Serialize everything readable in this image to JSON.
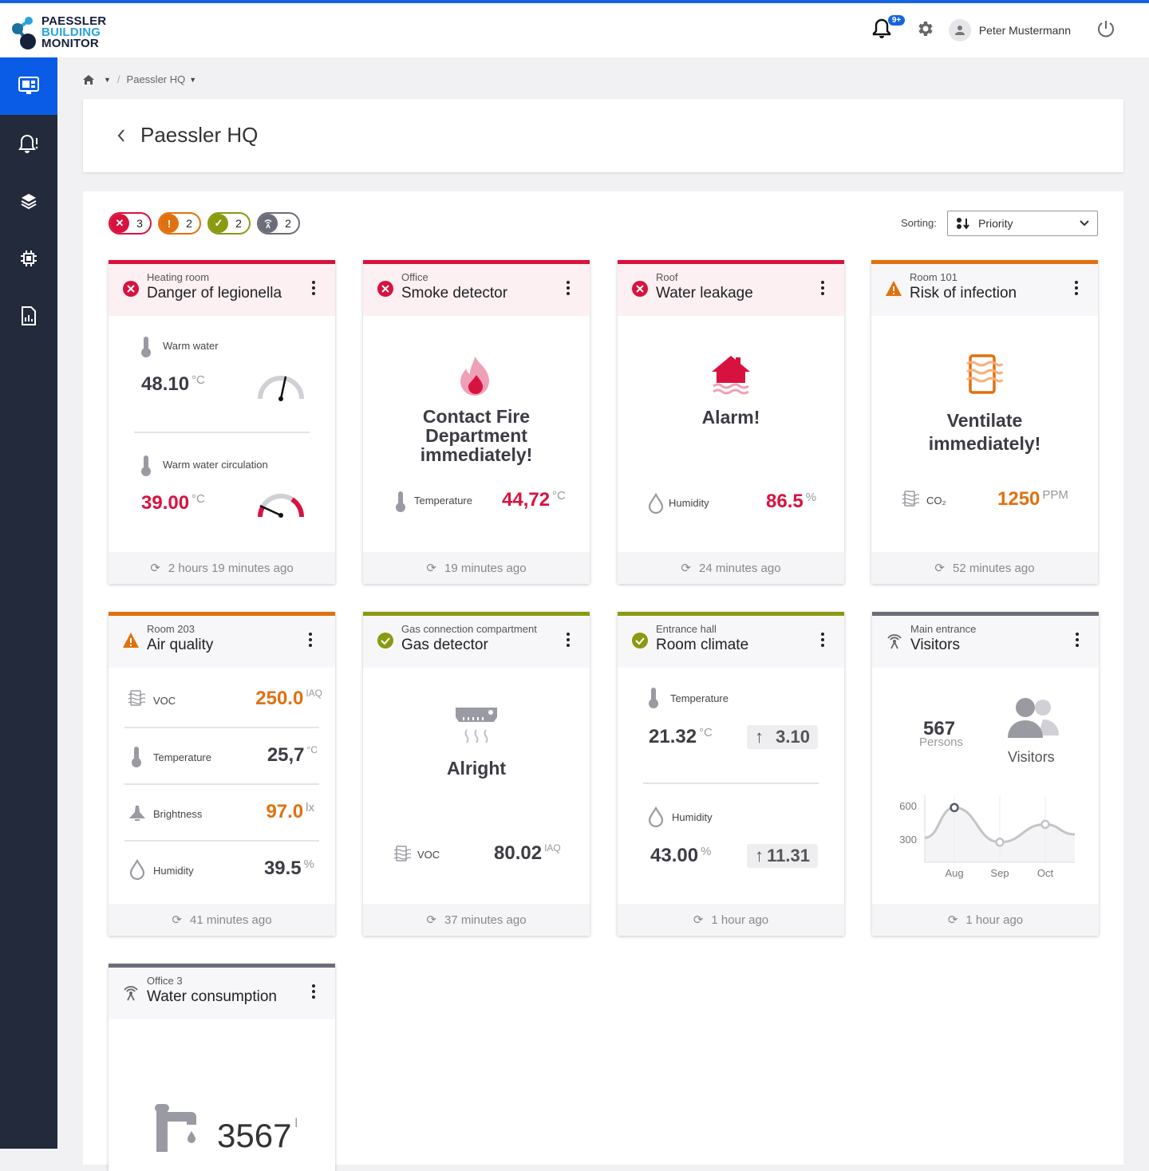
{
  "app": {
    "logo_lines": [
      "PAESSLER",
      "BUILDING",
      "MONITOR"
    ],
    "notification_badge": "9+",
    "user_name": "Peter Mustermann"
  },
  "sidebar": {
    "items": [
      {
        "name": "dashboard",
        "active": true
      },
      {
        "name": "alarms"
      },
      {
        "name": "layers"
      },
      {
        "name": "devices"
      },
      {
        "name": "reports"
      }
    ]
  },
  "breadcrumb": {
    "current": "Paessler HQ"
  },
  "header": {
    "title": "Paessler HQ"
  },
  "filters": [
    {
      "status": "error",
      "count": "3",
      "color": "#d8123f"
    },
    {
      "status": "warning",
      "count": "2",
      "color": "#e0710f"
    },
    {
      "status": "ok",
      "count": "2",
      "color": "#8a9a12"
    },
    {
      "status": "offline",
      "count": "2",
      "color": "#6b6d78"
    }
  ],
  "sorting": {
    "label": "Sorting:",
    "value": "Priority"
  },
  "cards": [
    {
      "location": "Heating room",
      "name": "Danger of legionella",
      "status": "error",
      "updated": "2 hours 19 minutes ago",
      "readings": [
        {
          "label": "Warm water",
          "value": "48.10",
          "unit": "°C",
          "gauge": 0.55
        },
        {
          "label": "Warm water circulation",
          "value": "39.00",
          "unit": "°C",
          "gauge": 0.2
        }
      ]
    },
    {
      "location": "Office",
      "name": "Smoke detector",
      "status": "error",
      "updated": "19 minutes ago",
      "message": [
        "Contact Fire",
        "Department",
        "immediately!"
      ],
      "readings": [
        {
          "label": "Temperature",
          "value": "44,72",
          "unit": "°C"
        }
      ]
    },
    {
      "location": "Roof",
      "name": "Water leakage",
      "status": "error",
      "updated": "24 minutes ago",
      "message": [
        "Alarm!"
      ],
      "readings": [
        {
          "label": "Humidity",
          "value": "86.5",
          "unit": "%"
        }
      ]
    },
    {
      "location": "Room 101",
      "name": "Risk of infection",
      "status": "warning",
      "updated": "52 minutes ago",
      "message": [
        "Ventilate",
        "immediately!"
      ],
      "readings": [
        {
          "label": "CO₂",
          "value": "1250",
          "unit": "PPM"
        }
      ]
    },
    {
      "location": "Room 203",
      "name": "Air quality",
      "status": "warning",
      "updated": "41 minutes ago",
      "readings": [
        {
          "label": "VOC",
          "value": "250.0",
          "unit": "IAQ"
        },
        {
          "label": "Temperature",
          "value": "25,7",
          "unit": "°C"
        },
        {
          "label": "Brightness",
          "value": "97.0",
          "unit": "lx"
        },
        {
          "label": "Humidity",
          "value": "39.5",
          "unit": "%"
        }
      ]
    },
    {
      "location": "Gas connection compartment",
      "name": "Gas detector",
      "status": "ok",
      "updated": "37 minutes ago",
      "message": [
        "Alright"
      ],
      "readings": [
        {
          "label": "VOC",
          "value": "80.02",
          "unit": "IAQ"
        }
      ]
    },
    {
      "location": "Entrance hall",
      "name": "Room climate",
      "status": "ok",
      "updated": "1 hour ago",
      "readings": [
        {
          "label": "Temperature",
          "value": "21.32",
          "unit": "°C",
          "delta": "3.10"
        },
        {
          "label": "Humidity",
          "value": "43.00",
          "unit": "%",
          "delta": "11.31"
        }
      ]
    },
    {
      "location": "Main entrance",
      "name": "Visitors",
      "status": "offline",
      "updated": "1 hour ago",
      "count": "567",
      "count_label": "Persons",
      "icon_label": "Visitors"
    },
    {
      "location": "Office 3",
      "name": "Water consumption",
      "status": "offline",
      "value": "3567",
      "unit": "l"
    }
  ],
  "chart_data": {
    "type": "line",
    "title": "",
    "xlabel": "",
    "ylabel": "",
    "categories": [
      "",
      "Aug",
      "Sep",
      "Oct",
      ""
    ],
    "x": [
      0.35,
      1,
      2,
      3,
      3.65
    ],
    "values": [
      320,
      590,
      280,
      440,
      350
    ],
    "yticks": [
      300,
      600
    ],
    "ylim": [
      100,
      700
    ],
    "xlim": [
      0.35,
      3.65
    ],
    "grid": true
  }
}
